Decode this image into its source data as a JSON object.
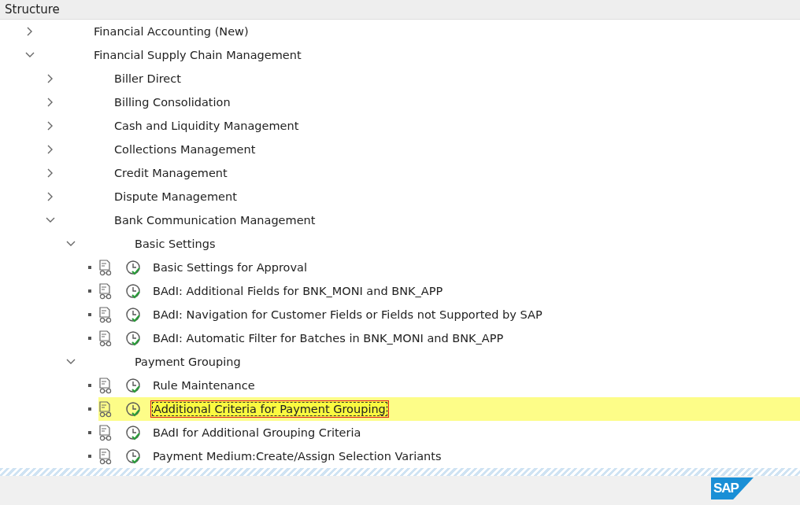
{
  "header": {
    "title": "Structure"
  },
  "tree": [
    {
      "label": "Financial Accounting (New)",
      "expanded": false
    },
    {
      "label": "Financial Supply Chain Management",
      "expanded": true,
      "children": [
        {
          "label": "Biller Direct",
          "expanded": false
        },
        {
          "label": "Billing Consolidation",
          "expanded": false
        },
        {
          "label": "Cash and Liquidity Management",
          "expanded": false
        },
        {
          "label": "Collections Management",
          "expanded": false
        },
        {
          "label": "Credit Management",
          "expanded": false
        },
        {
          "label": "Dispute Management",
          "expanded": false
        },
        {
          "label": "Bank Communication Management",
          "expanded": true,
          "children": [
            {
              "label": "Basic Settings",
              "expanded": true,
              "children": [
                {
                  "kind": "activity",
                  "label": "Basic Settings for Approval",
                  "selected": false
                },
                {
                  "kind": "activity",
                  "label": "BAdI: Additional Fields for BNK_MONI and BNK_APP",
                  "selected": false
                },
                {
                  "kind": "activity",
                  "label": "BAdI: Navigation for Customer Fields or Fields not Supported by SAP",
                  "selected": false
                },
                {
                  "kind": "activity",
                  "label": "BAdI: Automatic Filter for Batches in BNK_MONI and BNK_APP",
                  "selected": false
                }
              ]
            },
            {
              "label": "Payment Grouping",
              "expanded": true,
              "children": [
                {
                  "kind": "activity",
                  "label": "Rule Maintenance",
                  "selected": false
                },
                {
                  "kind": "activity",
                  "label": "Additional Criteria for Payment Grouping",
                  "selected": true
                },
                {
                  "kind": "activity",
                  "label": "BAdI for Additional Grouping Criteria",
                  "selected": false
                },
                {
                  "kind": "activity",
                  "label": "Payment Medium:Create/Assign Selection Variants",
                  "selected": false
                }
              ]
            }
          ]
        }
      ]
    }
  ],
  "footer": {
    "logo": "SAP"
  }
}
